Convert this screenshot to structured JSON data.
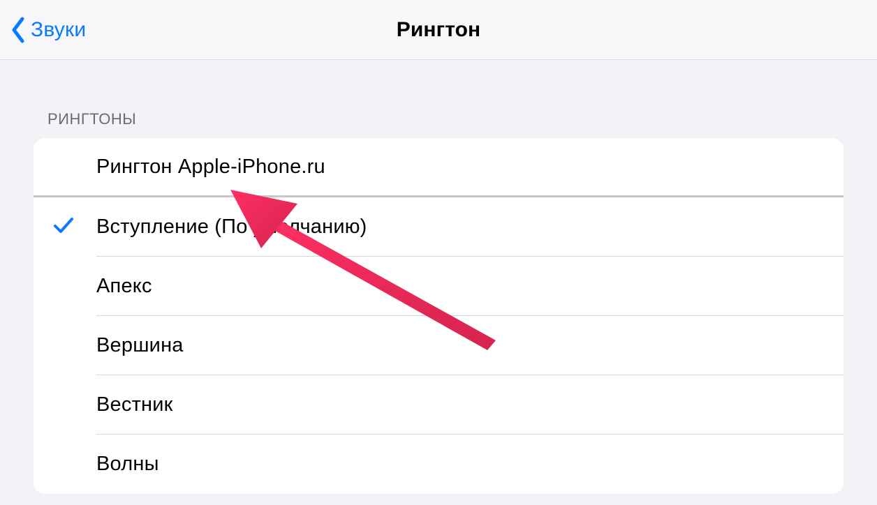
{
  "header": {
    "back_label": "Звуки",
    "title": "Рингтон"
  },
  "section": {
    "title": "РИНГТОНЫ"
  },
  "ringtones": {
    "custom": [
      {
        "label": "Рингтон Apple-iPhone.ru",
        "selected": false
      }
    ],
    "builtin": [
      {
        "label": "Вступление (По умолчанию)",
        "selected": true
      },
      {
        "label": "Апекс",
        "selected": false
      },
      {
        "label": "Вершина",
        "selected": false
      },
      {
        "label": "Вестник",
        "selected": false
      },
      {
        "label": "Волны",
        "selected": false
      }
    ]
  },
  "colors": {
    "accent": "#0a7aff",
    "arrow": "#e62e5c"
  }
}
